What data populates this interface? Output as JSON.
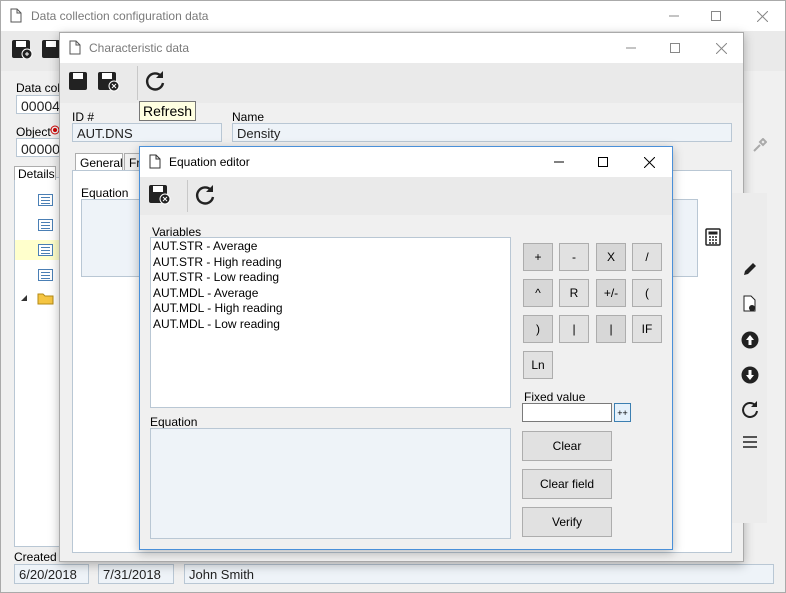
{
  "main_window": {
    "title": "Data collection configuration data",
    "data_collection_label": "Data coll",
    "data_collection_value": "00004",
    "object_label": "Object",
    "object_value": "00000",
    "details_tab": "Details",
    "created_label": "Created o",
    "created_date": "6/20/2018",
    "modified_date": "7/31/2018",
    "user": "John Smith"
  },
  "characteristic_window": {
    "title": "Characteristic data",
    "tooltip": "Refresh",
    "id_label": "ID #",
    "id_value": "AUT.DNS",
    "name_label": "Name",
    "name_value": "Density",
    "tabs": [
      "General",
      "Fr"
    ],
    "equation_label": "Equation"
  },
  "equation_editor": {
    "title": "Equation editor",
    "variables_label": "Variables",
    "variables": [
      "AUT.STR - Average",
      "AUT.STR - High reading",
      "AUT.STR - Low reading",
      "AUT.MDL - Average",
      "AUT.MDL - High reading",
      "AUT.MDL - Low reading"
    ],
    "equation_label": "Equation",
    "keypad": [
      "+",
      "-",
      "X",
      "/",
      "^",
      "R",
      "+/-",
      "(",
      ")",
      "|",
      "|",
      "IF",
      "Ln"
    ],
    "fixed_value_label": "Fixed value",
    "fixed_value": "",
    "add_button": "++",
    "clear_button": "Clear",
    "clear_field_button": "Clear field",
    "verify_button": "Verify"
  },
  "colors": {
    "field_bg": "#eef3f8",
    "field_border": "#b9c7d4",
    "active_border": "#4a90d9",
    "required_marker": "#d00000"
  }
}
